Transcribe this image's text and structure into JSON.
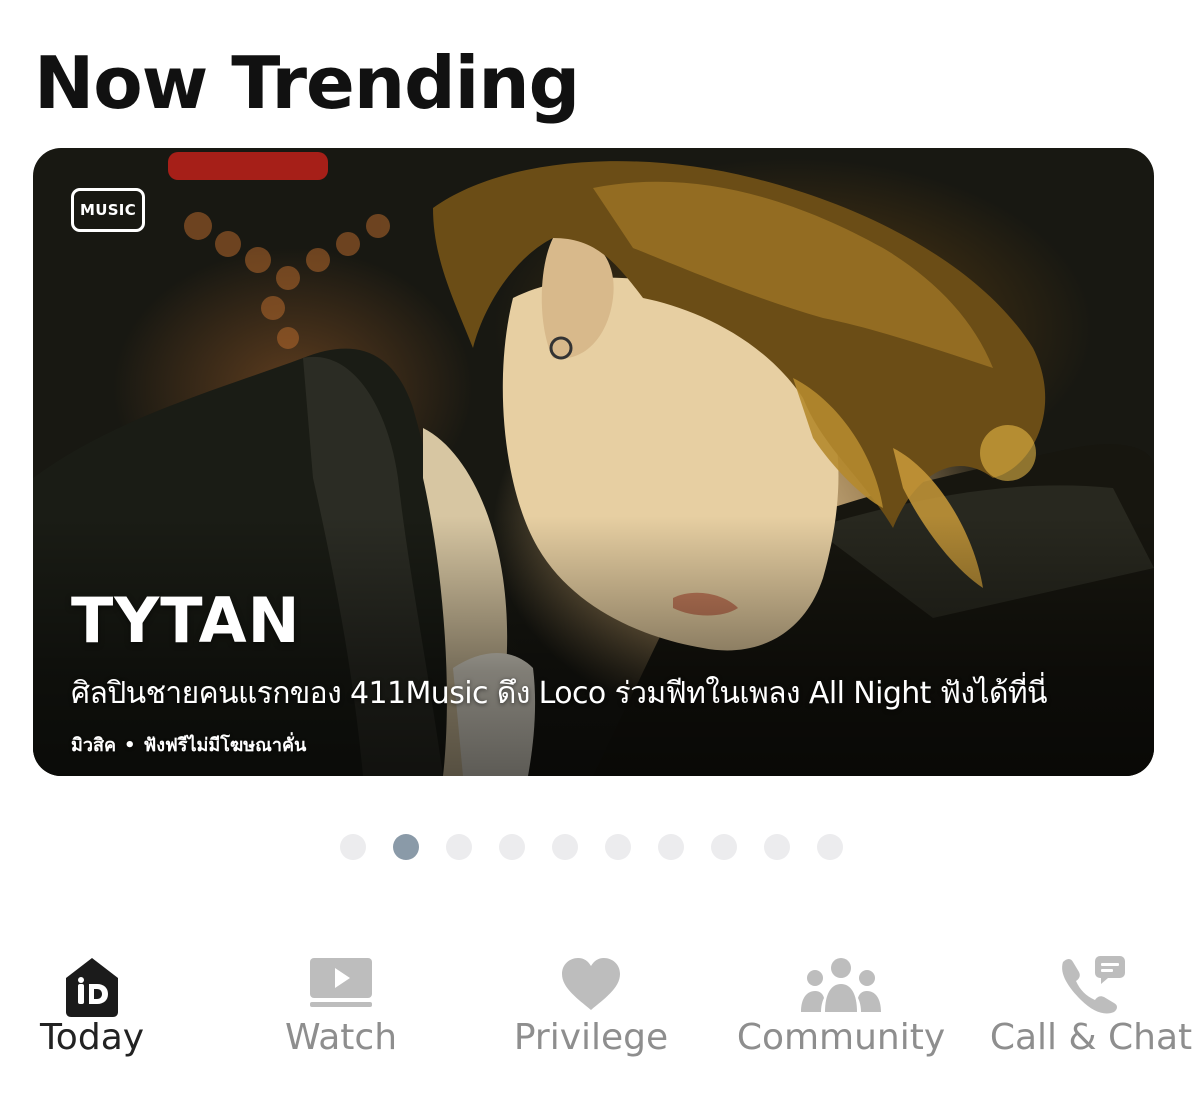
{
  "section": {
    "title": "Now Trending"
  },
  "banner": {
    "badge": "MUSIC",
    "artist": "TYTAN",
    "headline": "ศิลปินชายคนแรกของ 411Music ดึง Loco ร่วมฟีทในเพลง All Night ฟังได้ที่นี่",
    "category": "มิวสิค",
    "separator": "•",
    "subtitle": "ฟังฟรีไม่มีโฆษณาคั่น"
  },
  "pager": {
    "total": 10,
    "active_index": 1,
    "active_color": "#8a9aa8",
    "inactive_color": "#ececee"
  },
  "tabbar": {
    "items": [
      {
        "label": "Today",
        "icon": "today-home-icon",
        "active": true
      },
      {
        "label": "Watch",
        "icon": "play-tv-icon",
        "active": false
      },
      {
        "label": "Privilege",
        "icon": "heart-icon",
        "active": false
      },
      {
        "label": "Community",
        "icon": "people-group-icon",
        "active": false
      },
      {
        "label": "Call & Chat",
        "icon": "phone-chat-icon",
        "active": false
      }
    ]
  },
  "colors": {
    "active_tab": "#222222",
    "inactive_tab": "#8e8e8e"
  }
}
